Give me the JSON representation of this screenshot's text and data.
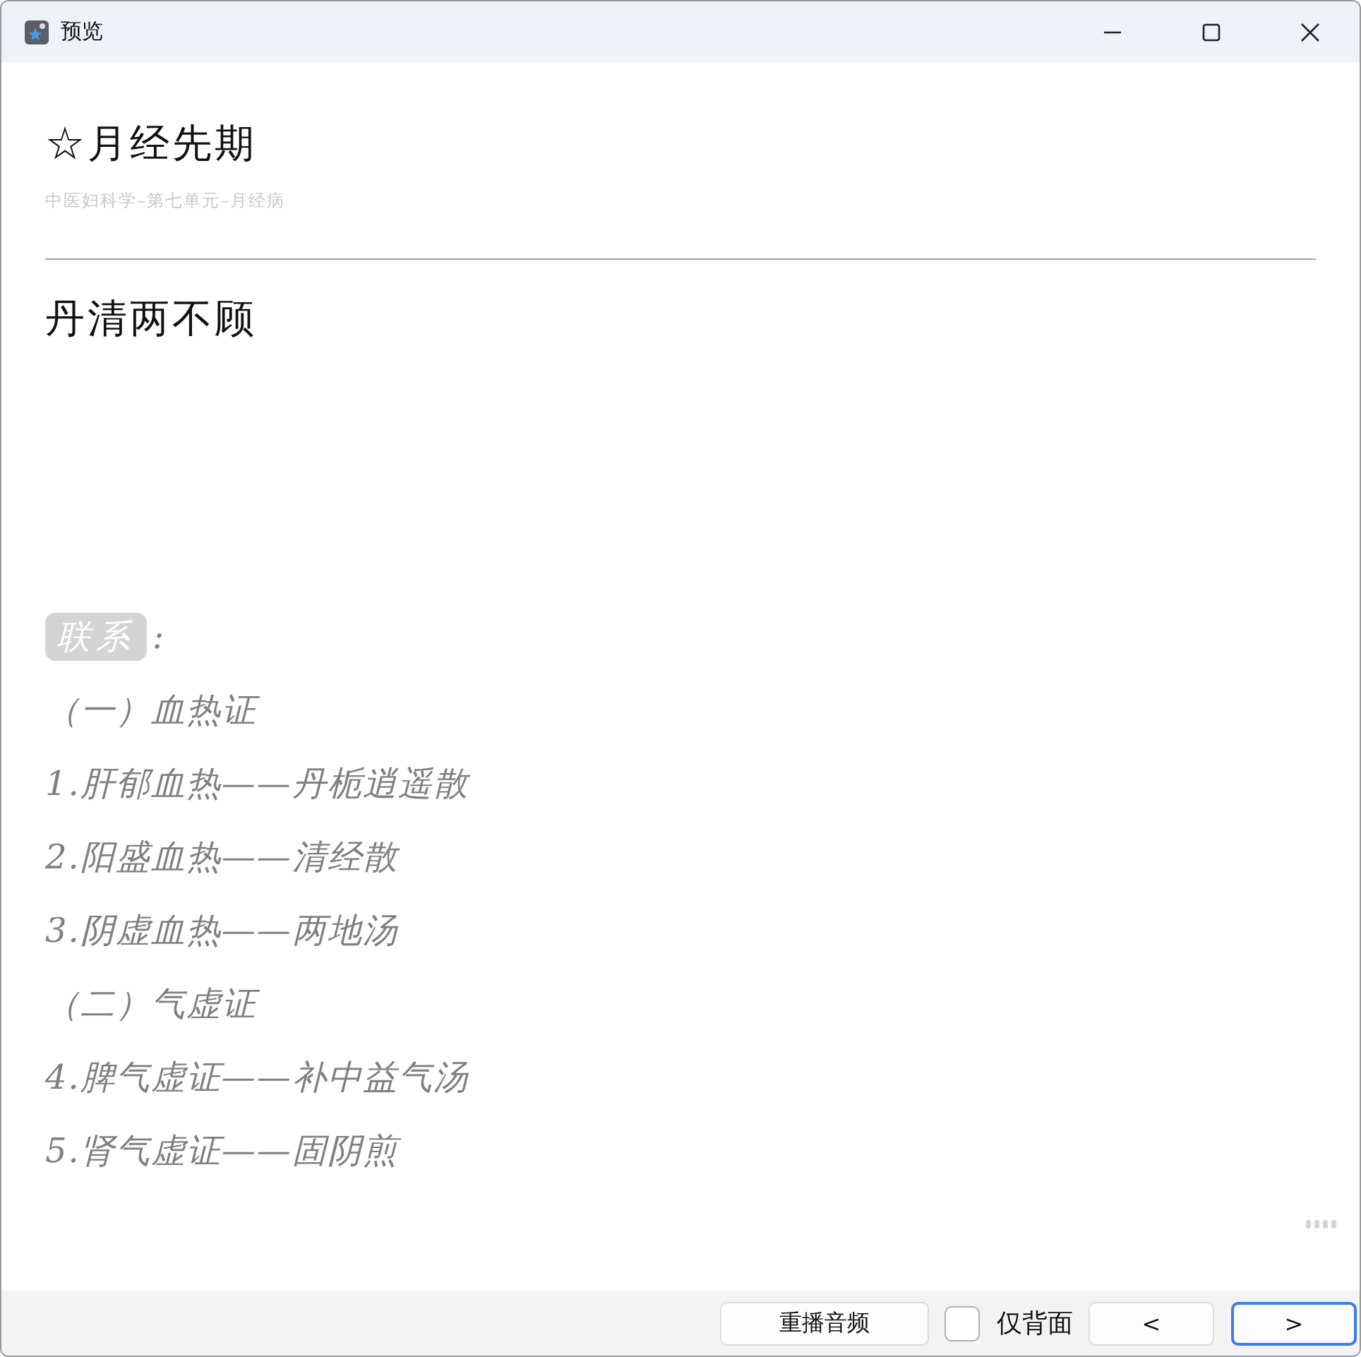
{
  "window": {
    "title": "预览"
  },
  "card": {
    "title": "☆月经先期",
    "deck": "中医妇科学–第七单元–月经病",
    "answer": "丹清两不顾",
    "notes": {
      "tag": "联系",
      "colon": ":",
      "lines": [
        "（一）血热证",
        "1.肝郁血热——丹栀逍遥散",
        "2.阳盛血热——清经散",
        "3.阴虚血热——两地汤",
        "（二）气虚证",
        "4.脾气虚证——补中益气汤",
        "5.肾气虚证——固阴煎"
      ]
    }
  },
  "footer": {
    "replay": "重播音频",
    "back_only": {
      "label": "仅背面",
      "checked": false
    },
    "prev": "<",
    "next": ">"
  }
}
